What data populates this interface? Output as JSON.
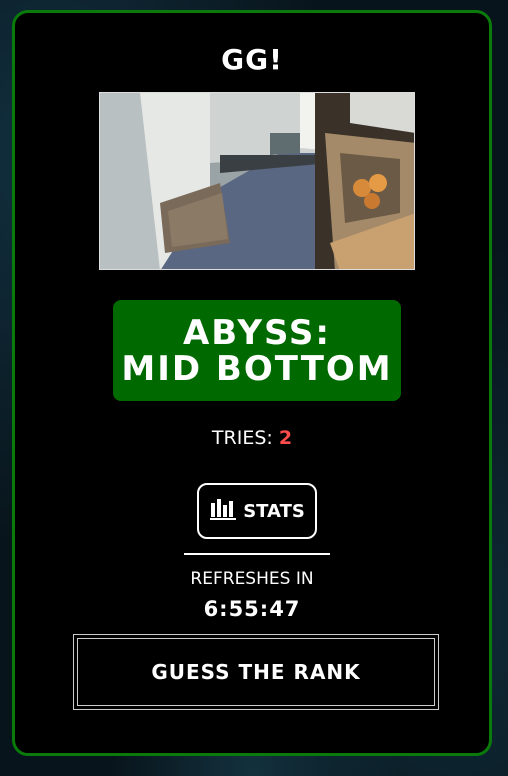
{
  "header": {
    "title": "GG!"
  },
  "answer": {
    "line1": "ABYSS:",
    "line2": "MID BOTTOM"
  },
  "tries": {
    "label": "TRIES:",
    "count": "2"
  },
  "stats_button": {
    "label": "STATS",
    "icon": "bar-chart-icon"
  },
  "refresh": {
    "label": "REFRESHES IN",
    "time": "6:55:47"
  },
  "guess_button": {
    "label": "GUESS THE RANK"
  },
  "colors": {
    "border": "#0a7a0a",
    "answer_bg": "#006a00",
    "tries_count": "#ff4d4d"
  }
}
